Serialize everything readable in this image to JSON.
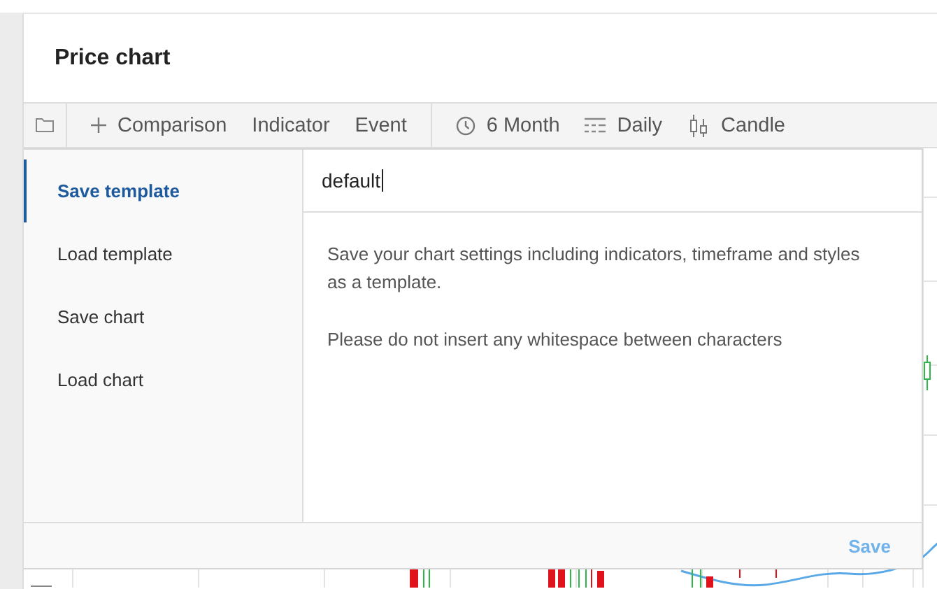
{
  "title": "Price chart",
  "toolbar": {
    "groups": [
      [
        {
          "kind": "folder"
        }
      ],
      [
        {
          "kind": "add",
          "label": "Comparison"
        },
        {
          "kind": "text",
          "label": "Indicator"
        },
        {
          "kind": "text",
          "label": "Event"
        }
      ],
      [
        {
          "kind": "clock",
          "label": "6 Month"
        },
        {
          "kind": "lines",
          "label": "Daily"
        },
        {
          "kind": "candles",
          "label": "Candle"
        }
      ]
    ]
  },
  "dialog": {
    "menu": [
      {
        "label": "Save template",
        "selected": true
      },
      {
        "label": "Load template",
        "selected": false
      },
      {
        "label": "Save chart",
        "selected": false
      },
      {
        "label": "Load chart",
        "selected": false
      }
    ],
    "name_field": {
      "value": "default"
    },
    "paragraphs": [
      "Save your chart settings including indicators, timeframe and styles as a template.",
      "Please do not insert any whitespace between characters"
    ],
    "save_button": "Save"
  }
}
